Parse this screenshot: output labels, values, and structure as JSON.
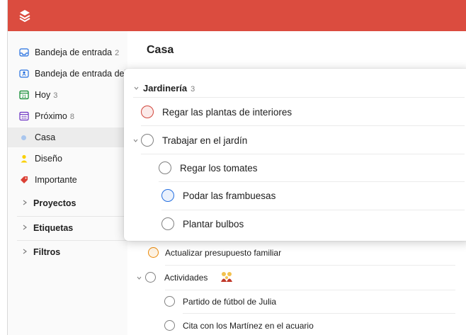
{
  "colors": {
    "brand": "#db4c3f",
    "priority_red": "#d1453b",
    "priority_orange": "#eb8909",
    "priority_blue": "#246fe0",
    "casa_dot": "#a9c6ee",
    "diseno_tag": "#fad000",
    "importante_tag": "#db4035"
  },
  "app": {
    "logo_icon": "todoist-logo-icon"
  },
  "sidebar": {
    "items": [
      {
        "label": "Bandeja de entrada",
        "count": "2",
        "icon": "inbox-icon"
      },
      {
        "label": "Bandeja de entrada del",
        "count": "",
        "icon": "team-inbox-icon"
      },
      {
        "label": "Hoy",
        "count": "3",
        "icon": "calendar-today-icon",
        "day": "21"
      },
      {
        "label": "Próximo",
        "count": "8",
        "icon": "calendar-upcoming-icon"
      },
      {
        "label": "Casa",
        "count": "",
        "icon": "project-dot-icon"
      },
      {
        "label": "Diseño",
        "count": "",
        "icon": "person-icon"
      },
      {
        "label": "Importante",
        "count": "",
        "icon": "label-tag-icon"
      }
    ],
    "sections": [
      {
        "label": "Proyectos"
      },
      {
        "label": "Etiquetas"
      },
      {
        "label": "Filtros"
      }
    ]
  },
  "main": {
    "title": "Casa",
    "tasks": [
      {
        "label": "Actualizar presupuesto familiar"
      },
      {
        "label": "Actividades",
        "emoji_icon": "family-emoji-icon"
      },
      {
        "label": "Partido de fútbol de Julia"
      },
      {
        "label": "Cita con los Martínez en el acuario"
      }
    ]
  },
  "popup": {
    "section_title": "Jardinería",
    "section_count": "3",
    "tasks": [
      {
        "label": "Regar las plantas de interiores"
      },
      {
        "label": "Trabajar en el jardín"
      },
      {
        "label": "Regar los tomates"
      },
      {
        "label": "Podar las frambuesas"
      },
      {
        "label": "Plantar bulbos"
      }
    ]
  }
}
